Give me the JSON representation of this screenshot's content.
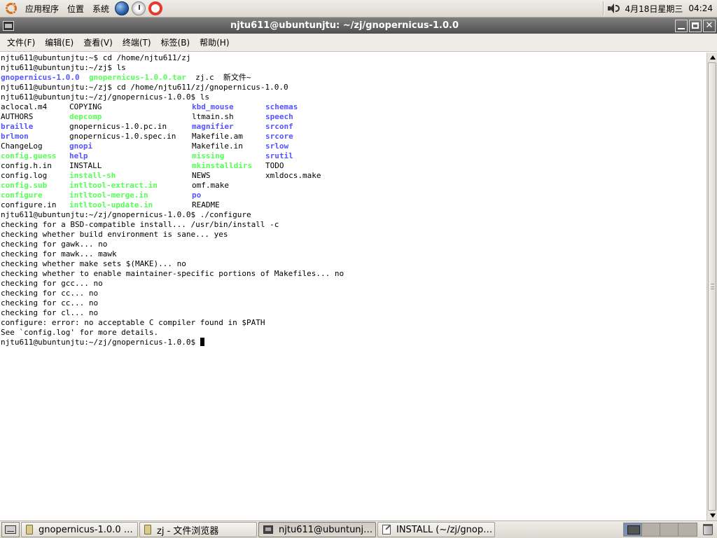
{
  "top_panel": {
    "menus": [
      "应用程序",
      "位置",
      "系统"
    ],
    "launchers": [
      "globe-icon",
      "mail-icon",
      "help-icon"
    ],
    "volume_icon": "speaker-icon",
    "date": "4月18日星期三",
    "time": "04:24"
  },
  "window": {
    "title": "njtu611@ubuntunjtu: ~/zj/gnopernicus-1.0.0",
    "buttons": [
      "minimize",
      "maximize",
      "close"
    ]
  },
  "menubar": [
    "文件(F)",
    "编辑(E)",
    "查看(V)",
    "终端(T)",
    "标签(B)",
    "帮助(H)"
  ],
  "terminal": {
    "prompt_lines": [
      "njtu611@ubuntunjtu:~$ cd /home/njtu611/zj",
      "njtu611@ubuntunjtu:~/zj$ ls"
    ],
    "ls1": [
      {
        "text": "gnopernicus-1.0.0",
        "type": "dir"
      },
      {
        "text": "  ",
        "type": "plain"
      },
      {
        "text": "gnopernicus-1.0.0.tar",
        "type": "exe"
      },
      {
        "text": "  zj.c  新文件~",
        "type": "plain"
      }
    ],
    "cd_lines": [
      "njtu611@ubuntunjtu:~/zj$ cd /home/njtu611/zj/gnopernicus-1.0.0",
      "njtu611@ubuntunjtu:~/zj/gnopernicus-1.0.0$ ls"
    ],
    "ls_grid": [
      [
        {
          "t": "aclocal.m4",
          "k": "plain"
        },
        {
          "t": "COPYING",
          "k": "plain"
        },
        {
          "t": "kbd_mouse",
          "k": "dir"
        },
        {
          "t": "schemas",
          "k": "dir"
        }
      ],
      [
        {
          "t": "AUTHORS",
          "k": "plain"
        },
        {
          "t": "depcomp",
          "k": "exe"
        },
        {
          "t": "ltmain.sh",
          "k": "plain"
        },
        {
          "t": "speech",
          "k": "dir"
        }
      ],
      [
        {
          "t": "braille",
          "k": "dir"
        },
        {
          "t": "gnopernicus-1.0.pc.in",
          "k": "plain"
        },
        {
          "t": "magnifier",
          "k": "dir"
        },
        {
          "t": "srconf",
          "k": "dir"
        }
      ],
      [
        {
          "t": "brlmon",
          "k": "dir"
        },
        {
          "t": "gnopernicus-1.0.spec.in",
          "k": "plain"
        },
        {
          "t": "Makefile.am",
          "k": "plain"
        },
        {
          "t": "srcore",
          "k": "dir"
        }
      ],
      [
        {
          "t": "ChangeLog",
          "k": "plain"
        },
        {
          "t": "gnopi",
          "k": "dir"
        },
        {
          "t": "Makefile.in",
          "k": "plain"
        },
        {
          "t": "srlow",
          "k": "dir"
        }
      ],
      [
        {
          "t": "config.guess",
          "k": "exe"
        },
        {
          "t": "help",
          "k": "dir"
        },
        {
          "t": "missing",
          "k": "exe"
        },
        {
          "t": "srutil",
          "k": "dir"
        }
      ],
      [
        {
          "t": "config.h.in",
          "k": "plain"
        },
        {
          "t": "INSTALL",
          "k": "plain"
        },
        {
          "t": "mkinstalldirs",
          "k": "exe"
        },
        {
          "t": "TODO",
          "k": "plain"
        }
      ],
      [
        {
          "t": "config.log",
          "k": "plain"
        },
        {
          "t": "install-sh",
          "k": "exe"
        },
        {
          "t": "NEWS",
          "k": "plain"
        },
        {
          "t": "xmldocs.make",
          "k": "plain"
        }
      ],
      [
        {
          "t": "config.sub",
          "k": "exe"
        },
        {
          "t": "intltool-extract.in",
          "k": "exe"
        },
        {
          "t": "omf.make",
          "k": "plain"
        },
        {
          "t": "",
          "k": "plain"
        }
      ],
      [
        {
          "t": "configure",
          "k": "exe"
        },
        {
          "t": "intltool-merge.in",
          "k": "exe"
        },
        {
          "t": "po",
          "k": "dir"
        },
        {
          "t": "",
          "k": "plain"
        }
      ],
      [
        {
          "t": "configure.in",
          "k": "plain"
        },
        {
          "t": "intltool-update.in",
          "k": "exe"
        },
        {
          "t": "README",
          "k": "plain"
        },
        {
          "t": "",
          "k": "plain"
        }
      ]
    ],
    "output_lines": [
      "njtu611@ubuntunjtu:~/zj/gnopernicus-1.0.0$ ./configure",
      "checking for a BSD-compatible install... /usr/bin/install -c",
      "checking whether build environment is sane... yes",
      "checking for gawk... no",
      "checking for mawk... mawk",
      "checking whether make sets $(MAKE)... no",
      "checking whether to enable maintainer-specific portions of Makefiles... no",
      "checking for gcc... no",
      "checking for cc... no",
      "checking for cc... no",
      "checking for cl... no",
      "configure: error: no acceptable C compiler found in $PATH",
      "See `config.log' for more details."
    ],
    "final_prompt": "njtu611@ubuntunjtu:~/zj/gnopernicus-1.0.0$ ",
    "colors": {
      "dir": "#5555ff",
      "exe": "#55ff55",
      "text": "#000000",
      "background": "#ffffff"
    }
  },
  "taskbar": {
    "tasks": [
      {
        "label": "gnopernicus-1.0.0 …",
        "icon": "folder-icon",
        "active": false
      },
      {
        "label": "zj - 文件浏览器",
        "icon": "folder-icon",
        "active": false
      },
      {
        "label": "njtu611@ubuntunjt…",
        "icon": "terminal-icon",
        "active": true
      },
      {
        "label": "INSTALL (~/zj/gnop…",
        "icon": "text-editor-icon",
        "active": false
      }
    ],
    "workspaces": 4,
    "active_workspace": 1
  }
}
